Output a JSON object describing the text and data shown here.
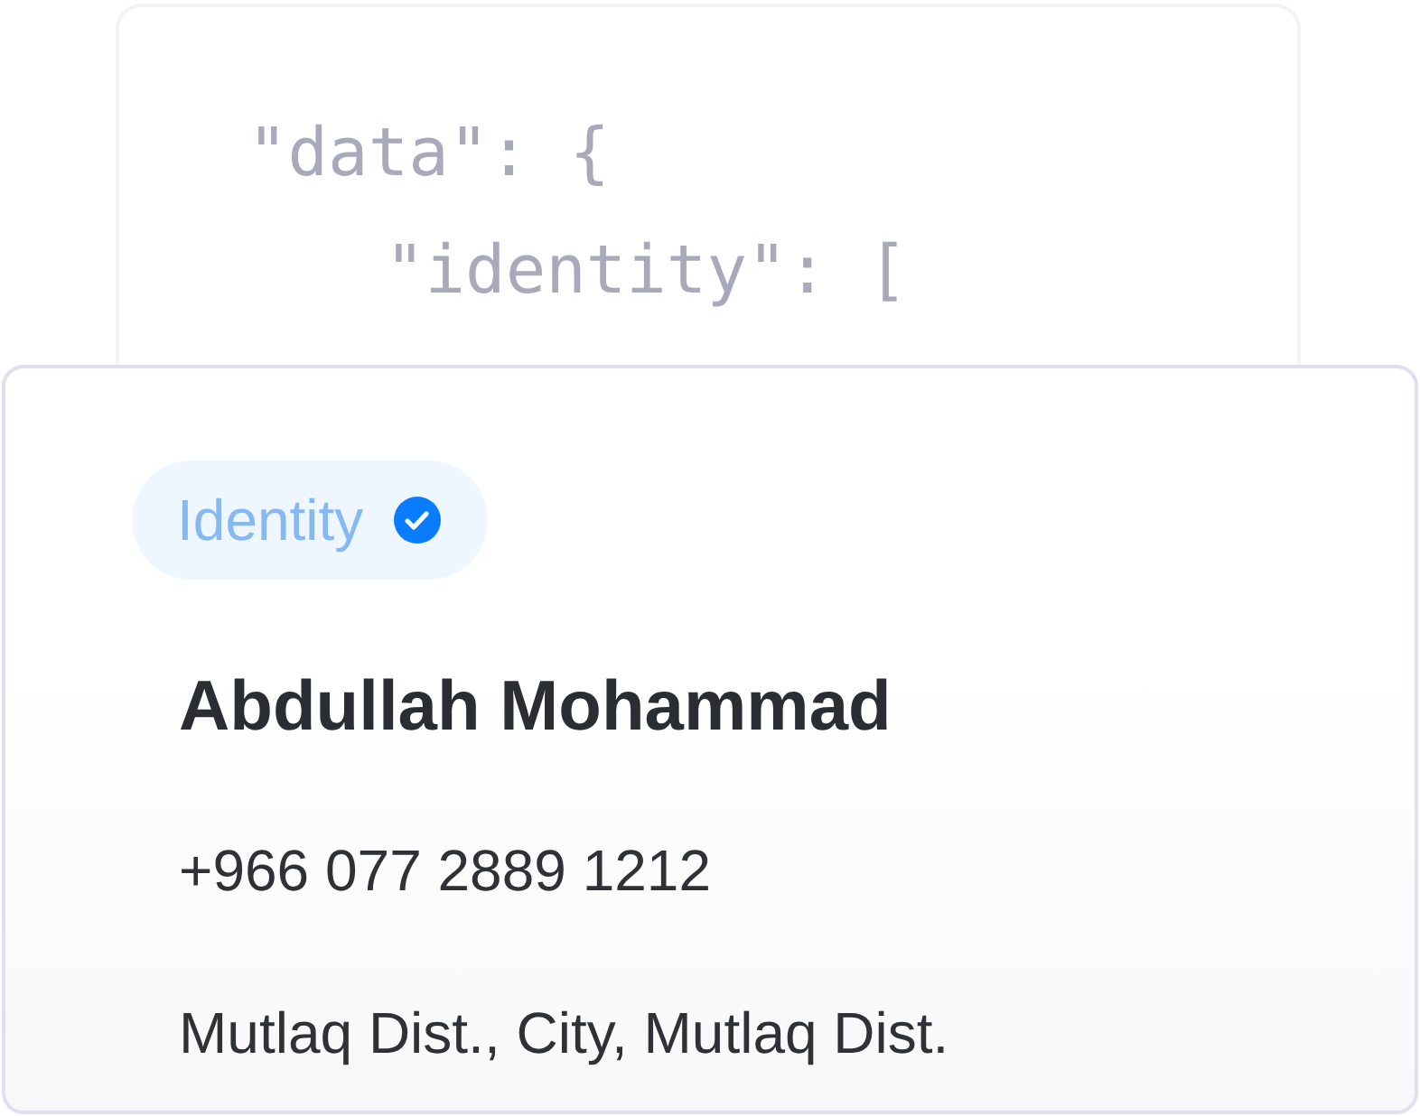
{
  "code_preview": {
    "lines": [
      {
        "text": "\"data\": {",
        "children": [
          {
            "text": "\"identity\": ["
          }
        ]
      }
    ]
  },
  "card": {
    "badge": {
      "label": "Identity",
      "verified": true
    },
    "name": "Abdullah Mohammad",
    "phone": "+966 077 2889 1212",
    "address": "Mutlaq Dist., City, Mutlaq Dist."
  }
}
